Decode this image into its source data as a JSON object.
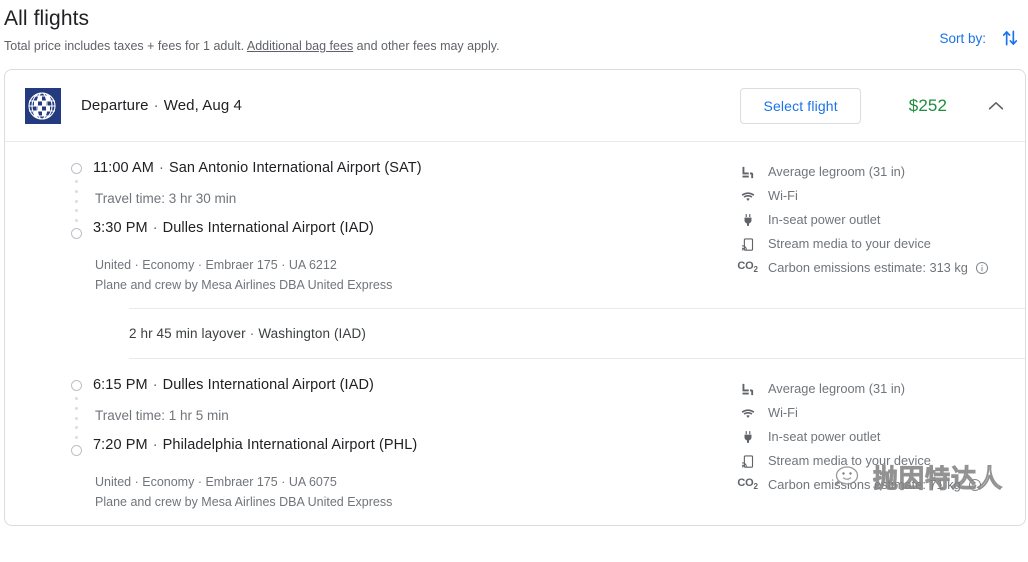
{
  "header": {
    "title": "All flights",
    "subtitle_before": "Total price includes taxes + fees for 1 adult. ",
    "subtitle_link": "Additional bag fees",
    "subtitle_after": " and other fees may apply.",
    "sort_label": "Sort by:",
    "sort_icon": "sort-arrows-icon",
    "sort_color": "#1a73e8"
  },
  "flight_card": {
    "airline_logo": "united-globe-logo",
    "direction_label": "Departure",
    "separator": "·",
    "date": "Wed, Aug 4",
    "select_button": "Select flight",
    "price": "$252",
    "price_color": "#1e8e3e",
    "collapse_icon": "chevron-up-icon",
    "legs": [
      {
        "depart_time": "11:00 AM",
        "depart_airport": "San Antonio International Airport (SAT)",
        "travel_time": "Travel time: 3 hr 30 min",
        "arrive_time": "3:30 PM",
        "arrive_airport": "Dulles International Airport (IAD)",
        "meta_line1": "United · Economy · Embraer 175 · UA 6212",
        "meta_line2": "Plane and crew by Mesa Airlines DBA United Express",
        "amenities": [
          {
            "icon": "legroom-seat-icon",
            "label": "Average legroom (31 in)"
          },
          {
            "icon": "wifi-icon",
            "label": "Wi-Fi"
          },
          {
            "icon": "power-plug-icon",
            "label": "In-seat power outlet"
          },
          {
            "icon": "cast-stream-icon",
            "label": "Stream media to your device"
          },
          {
            "icon": "co2-icon",
            "label": "Carbon emissions estimate: 313 kg",
            "info_icon": "info-circle-icon"
          }
        ]
      },
      {
        "depart_time": "6:15 PM",
        "depart_airport": "Dulles International Airport (IAD)",
        "travel_time": "Travel time: 1 hr 5 min",
        "arrive_time": "7:20 PM",
        "arrive_airport": "Philadelphia International Airport (PHL)",
        "meta_line1": "United · Economy · Embraer 175 · UA 6075",
        "meta_line2": "Plane and crew by Mesa Airlines DBA United Express",
        "amenities": [
          {
            "icon": "legroom-seat-icon",
            "label": "Average legroom (31 in)"
          },
          {
            "icon": "wifi-icon",
            "label": "Wi-Fi"
          },
          {
            "icon": "power-plug-icon",
            "label": "In-seat power outlet"
          },
          {
            "icon": "cast-stream-icon",
            "label": "Stream media to your device"
          },
          {
            "icon": "co2-icon",
            "label": "Carbon emissions estimate: 71 kg",
            "info_icon": "info-circle-icon"
          }
        ]
      }
    ],
    "layover": {
      "duration": "2 hr 45 min layover",
      "separator": "·",
      "city": "Washington (IAD)"
    }
  },
  "watermark": {
    "icon": "wechat-bubble-icon",
    "text": "抛因特达人"
  }
}
